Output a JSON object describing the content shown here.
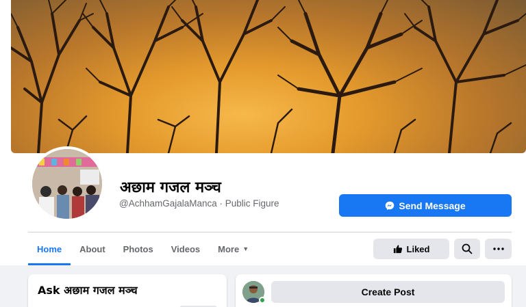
{
  "page": {
    "name": "अछाम गजल मञ्च",
    "handle_category": "@AchhamGajalaManca · Public Figure"
  },
  "actions": {
    "send_message": "Send Message",
    "liked": "Liked"
  },
  "tabs": [
    {
      "label": "Home",
      "active": true
    },
    {
      "label": "About"
    },
    {
      "label": "Photos"
    },
    {
      "label": "Videos"
    },
    {
      "label": "More"
    }
  ],
  "ask_card": {
    "title": "Ask अछाम गजल मञ्च"
  },
  "create_post": {
    "label": "Create Post"
  },
  "colors": {
    "primary": "#1877f2",
    "secondary_bg": "#e4e6eb",
    "muted_text": "#65676b",
    "online": "#31a24c"
  },
  "icons": {
    "messenger": "messenger-icon",
    "liked": "thumbs-up-icon",
    "search": "search-icon",
    "more": "more-dots-icon",
    "dropdown": "caret-down-icon"
  }
}
